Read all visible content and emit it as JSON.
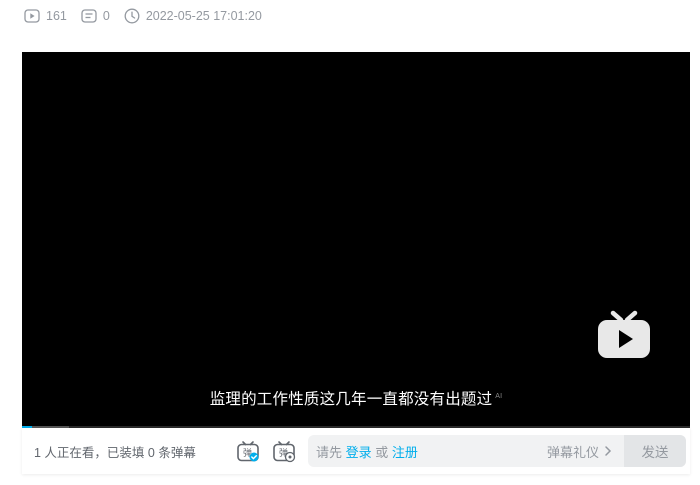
{
  "meta": {
    "play_count": "161",
    "danmaku_count": "0",
    "datetime": "2022-05-25 17:01:20"
  },
  "player": {
    "subtitle": "监理的工作性质这几年一直都没有出题过",
    "subtitle_badge": "AI",
    "progress": 0.015,
    "buffered": 0.07,
    "accent_color": "#00aeec"
  },
  "danmaku_bar": {
    "watch_info": "1 人正在看，已装填 0 条弹幕",
    "input_prefix": "请先",
    "login_link": "登录",
    "or_text": "或",
    "register_link": "注册",
    "etiquette": "弹幕礼仪",
    "send_label": "发送"
  },
  "icons": [
    "play-count-icon",
    "danmaku-count-icon",
    "clock-icon",
    "bilibili-tv-icon",
    "danmaku-toggle-icon",
    "danmaku-settings-icon",
    "chevron-right-icon"
  ]
}
